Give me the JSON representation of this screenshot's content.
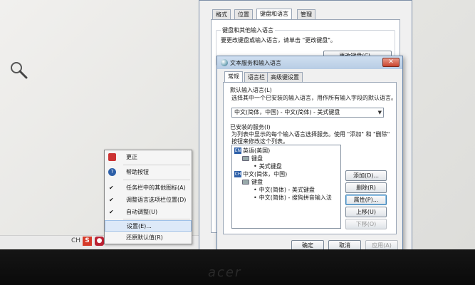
{
  "taskbar": {
    "label": "CH"
  },
  "context_menu": {
    "items": [
      {
        "label": "更正",
        "check": "",
        "icon": "document-icon"
      },
      {
        "label": "帮助按钮",
        "check": "",
        "icon": "help-icon"
      },
      {
        "label": "任务栏中的其他图标(A)",
        "check": "✔"
      },
      {
        "label": "调整语言选项栏位置(D)",
        "check": "✔"
      },
      {
        "label": "自动调整(U)",
        "check": "✔"
      },
      {
        "label": "设置(E)...",
        "check": ""
      },
      {
        "label": "还原默认值(R)",
        "check": ""
      }
    ]
  },
  "back_dialog": {
    "tabs": [
      "格式",
      "位置",
      "键盘和语言",
      "管理"
    ],
    "selected_tab": "键盘和语言",
    "group_title": "键盘和其他输入语言",
    "group_text": "要更改键盘或输入语言，请单击 \"更改键盘\"。",
    "change_keyboard_button": "更改键盘(C)..."
  },
  "dialog": {
    "title": "文本服务和输入语言",
    "tabs": [
      "常规",
      "语言栏",
      "高级键设置"
    ],
    "selected_tab": "常规",
    "default_lang": {
      "title": "默认输入语言(L)",
      "desc": "选择其中一个已安装的输入语言，用作所有输入字段的默认语言。",
      "selected": "中文(简体，中国) - 中文(简体) - 美式键盘"
    },
    "installed": {
      "title": "已安装的服务(I)",
      "desc1": "为列表中显示的每个输入语言选择服务。使用 \"添加\" 和 \"删除\"",
      "desc2": "按钮来修改这个列表。",
      "tree": {
        "en_badge": "EN",
        "en_lang": "英语(美国)",
        "en_keyboard": "键盘",
        "en_item": "美式键盘",
        "ch_badge": "CH",
        "ch_lang": "中文(简体，中国)",
        "ch_keyboard": "键盘",
        "ch_item1": "中文(简体) - 美式键盘",
        "ch_item2": "中文(简体) - 搜狗拼音输入法"
      }
    },
    "buttons": {
      "add": "添加(D)...",
      "remove": "删除(R)",
      "properties": "属性(P)...",
      "move_up": "上移(U)",
      "move_down": "下移(O)"
    },
    "footer": {
      "ok": "确定",
      "cancel": "取消",
      "apply": "应用(A)"
    }
  },
  "colors": {
    "accent": "#3c7fb1",
    "highlight": "#dde9f8"
  }
}
